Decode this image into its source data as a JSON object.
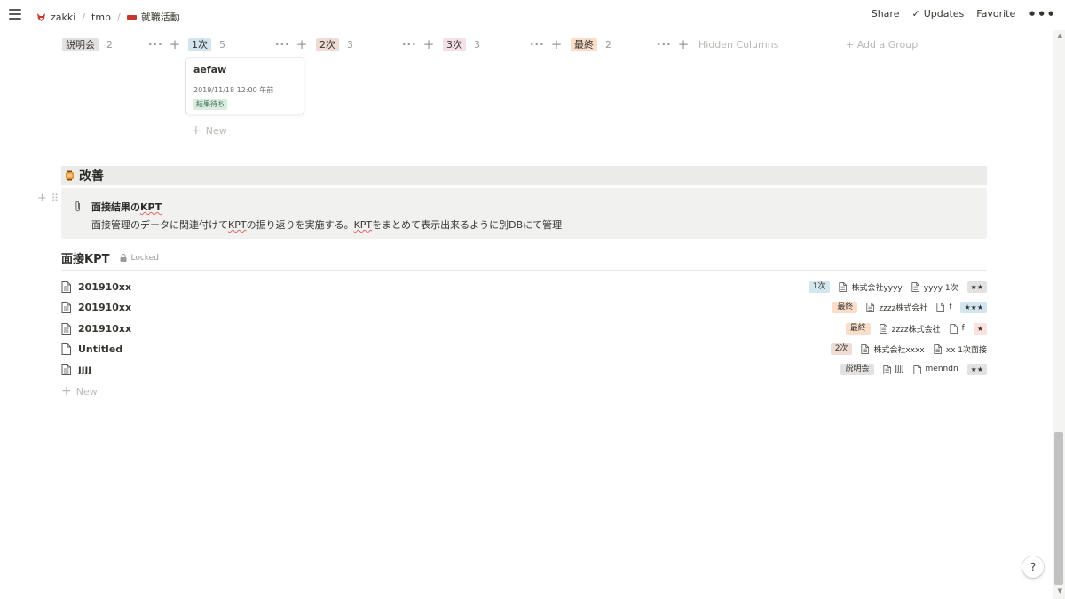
{
  "breadcrumb": [
    {
      "label": "zakki",
      "icon": "fox-icon"
    },
    {
      "label": "tmp"
    },
    {
      "label": "就職活動",
      "icon": "red-bar-icon"
    }
  ],
  "breadcrumb_sep": "/",
  "top_actions": {
    "share": "Share",
    "updates": "Updates",
    "favorite": "Favorite",
    "check_glyph": "✓",
    "more": "•••"
  },
  "board": {
    "columns": [
      {
        "label": "説明会",
        "count": "2",
        "color": "#e3e2e0"
      },
      {
        "label": "1次",
        "count": "5",
        "color": "#d3e5ef"
      },
      {
        "label": "2次",
        "count": "3",
        "color": "#eedcd5"
      },
      {
        "label": "3次",
        "count": "3",
        "color": "#f5e0e9"
      },
      {
        "label": "最終",
        "count": "2",
        "color": "#fadec9"
      }
    ],
    "more_glyph": "···",
    "plus_glyph": "+",
    "hidden_columns": "Hidden Columns",
    "add_group": "+ Add a Group",
    "card": {
      "title": "aefaw",
      "date": "2019/11/18 12:00 午前",
      "status": "結果待ち"
    },
    "new_label": "New"
  },
  "heading": {
    "text": "改善",
    "icon": "lantern-icon"
  },
  "callout": {
    "title_pre": "面接結果の",
    "title_kpt": "KPT",
    "body_1": "面接管理のデータに関連付けて",
    "body_kpt1": "KPT",
    "body_2": "の振り返りを実施する。",
    "body_kpt2": "KPT",
    "body_3": "をまとめて表示出来るように別DBにて管理"
  },
  "table": {
    "title": "面接KPT",
    "locked": "Locked",
    "rows": [
      {
        "title": "201910xx",
        "stage": "1次",
        "stage_color": "#d3e5ef",
        "company": "株式会社yyyy",
        "interview": "yyyy 1次",
        "stars": "★★",
        "stars_color": "#e3e2e0"
      },
      {
        "title": "201910xx",
        "stage": "最終",
        "stage_color": "#fadec9",
        "company": "zzzz株式会社",
        "interview": "f",
        "stars": "★★★",
        "stars_color": "#d3e5ef"
      },
      {
        "title": "201910xx",
        "stage": "最終",
        "stage_color": "#fadec9",
        "company": "zzzz株式会社",
        "interview": "f",
        "stars": "★",
        "stars_color": "#ffe2dd"
      },
      {
        "title": "Untitled",
        "stage": "2次",
        "stage_color": "#eedcd5",
        "company": "株式会社xxxx",
        "interview": "xx 1次面接",
        "stars": "",
        "stars_color": ""
      },
      {
        "title": "jjjj",
        "stage": "説明会",
        "stage_color": "#e3e2e0",
        "company": "jjjj",
        "interview": "menndn",
        "stars": "★★",
        "stars_color": "#e3e2e0"
      }
    ],
    "new_label": "New"
  },
  "help": "?",
  "scroll": {
    "up": "▲",
    "down": "▼"
  }
}
